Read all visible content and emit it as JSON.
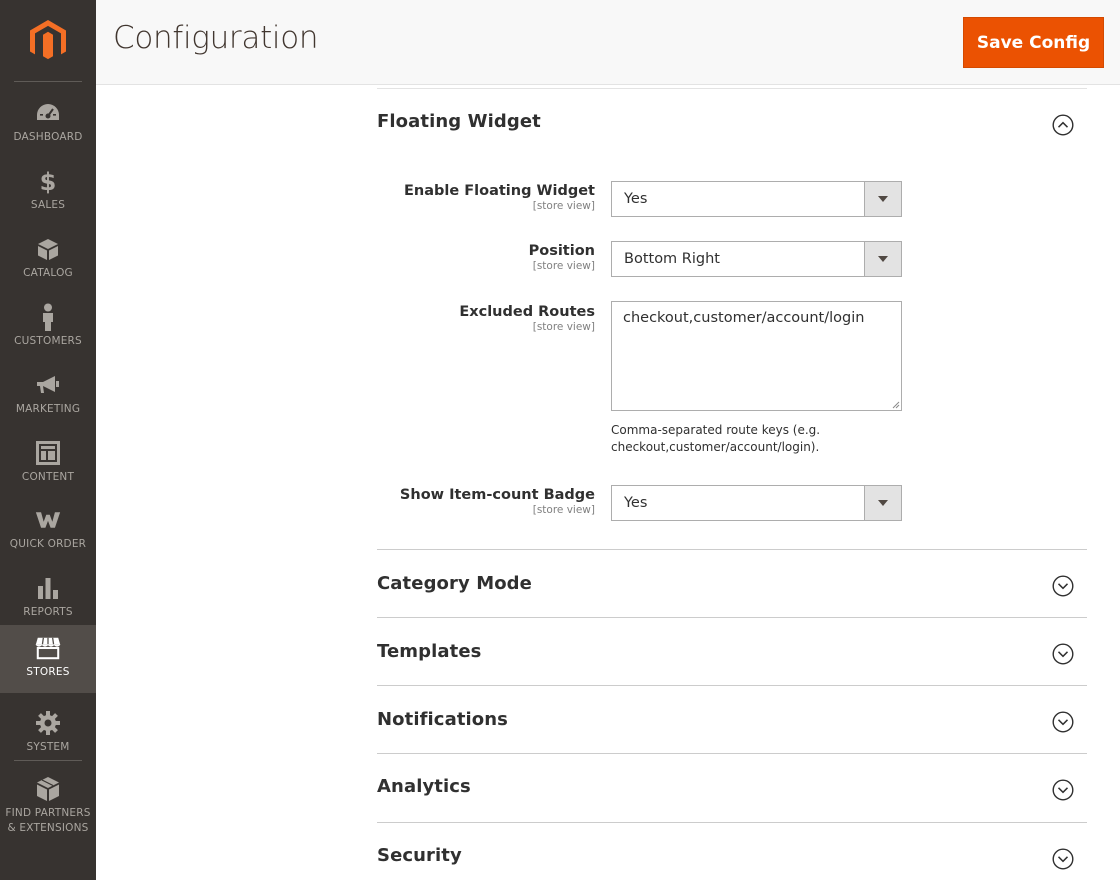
{
  "sidebar": {
    "logo": "magento-logo",
    "items": [
      {
        "label": "DASHBOARD",
        "icon": "dashboard-icon"
      },
      {
        "label": "SALES",
        "icon": "dollar-icon"
      },
      {
        "label": "CATALOG",
        "icon": "box-icon"
      },
      {
        "label": "CUSTOMERS",
        "icon": "person-icon"
      },
      {
        "label": "MARKETING",
        "icon": "megaphone-icon"
      },
      {
        "label": "CONTENT",
        "icon": "layout-icon"
      },
      {
        "label": "QUICK ORDER",
        "icon": "w-icon"
      },
      {
        "label": "REPORTS",
        "icon": "bar-chart-icon"
      },
      {
        "label": "STORES",
        "icon": "storefront-icon",
        "active": true
      },
      {
        "label": "SYSTEM",
        "icon": "gear-icon"
      },
      {
        "label_line1": "FIND PARTNERS",
        "label_line2": "& EXTENSIONS",
        "icon": "cube-icon"
      }
    ]
  },
  "header": {
    "title": "Configuration",
    "save_label": "Save Config"
  },
  "section": {
    "title": "Floating Widget",
    "expanded": true,
    "fields": {
      "enable": {
        "label": "Enable Floating Widget",
        "scope": "[store view]",
        "value": "Yes"
      },
      "position": {
        "label": "Position",
        "scope": "[store view]",
        "value": "Bottom Right"
      },
      "excluded": {
        "label": "Excluded Routes",
        "scope": "[store view]",
        "value": "checkout,customer/account/login",
        "note_line1": "Comma-separated route keys (e.g.",
        "note_line2": "checkout,customer/account/login)."
      },
      "badge": {
        "label": "Show Item-count Badge",
        "scope": "[store view]",
        "value": "Yes"
      }
    }
  },
  "collapsed_sections": [
    {
      "title": "Category Mode"
    },
    {
      "title": "Templates"
    },
    {
      "title": "Notifications"
    },
    {
      "title": "Analytics"
    },
    {
      "title": "Security"
    }
  ],
  "colors": {
    "sidebar_bg": "#373330",
    "active_bg": "#524d49",
    "accent": "#eb5202",
    "logo": "#f46f25"
  }
}
